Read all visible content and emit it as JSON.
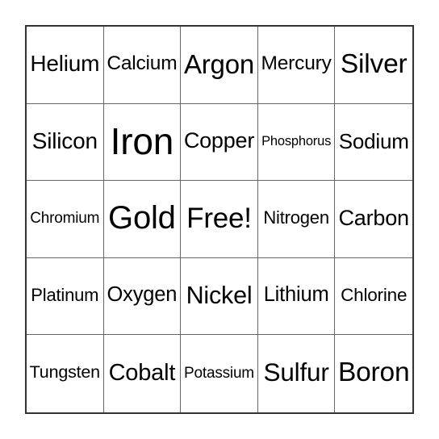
{
  "card": {
    "type": "bingo-card",
    "grid_size": 5,
    "free_space_label": "Free!",
    "free_space_position": {
      "row": 3,
      "column": 3
    },
    "text_color": "#000000",
    "cell_background": "#ffffff",
    "page_background": "#ffffff",
    "outer_border_color": "#333333",
    "inner_grid_color": "#666666",
    "rows": [
      {
        "cells": [
          {
            "label": "Helium",
            "is_free": false
          },
          {
            "label": "Calcium",
            "is_free": false
          },
          {
            "label": "Argon",
            "is_free": false
          },
          {
            "label": "Mercury",
            "is_free": false
          },
          {
            "label": "Silver",
            "is_free": false
          }
        ]
      },
      {
        "cells": [
          {
            "label": "Silicon",
            "is_free": false
          },
          {
            "label": "Iron",
            "is_free": false
          },
          {
            "label": "Copper",
            "is_free": false
          },
          {
            "label": "Phosphorus",
            "is_free": false
          },
          {
            "label": "Sodium",
            "is_free": false
          }
        ]
      },
      {
        "cells": [
          {
            "label": "Chromium",
            "is_free": false
          },
          {
            "label": "Gold",
            "is_free": false
          },
          {
            "label": "Free!",
            "is_free": true
          },
          {
            "label": "Nitrogen",
            "is_free": false
          },
          {
            "label": "Carbon",
            "is_free": false
          }
        ]
      },
      {
        "cells": [
          {
            "label": "Platinum",
            "is_free": false
          },
          {
            "label": "Oxygen",
            "is_free": false
          },
          {
            "label": "Nickel",
            "is_free": false
          },
          {
            "label": "Lithium",
            "is_free": false
          },
          {
            "label": "Chlorine",
            "is_free": false
          }
        ]
      },
      {
        "cells": [
          {
            "label": "Tungsten",
            "is_free": false
          },
          {
            "label": "Cobalt",
            "is_free": false
          },
          {
            "label": "Potassium",
            "is_free": false
          },
          {
            "label": "Sulfur",
            "is_free": false
          },
          {
            "label": "Boron",
            "is_free": false
          }
        ]
      }
    ]
  }
}
